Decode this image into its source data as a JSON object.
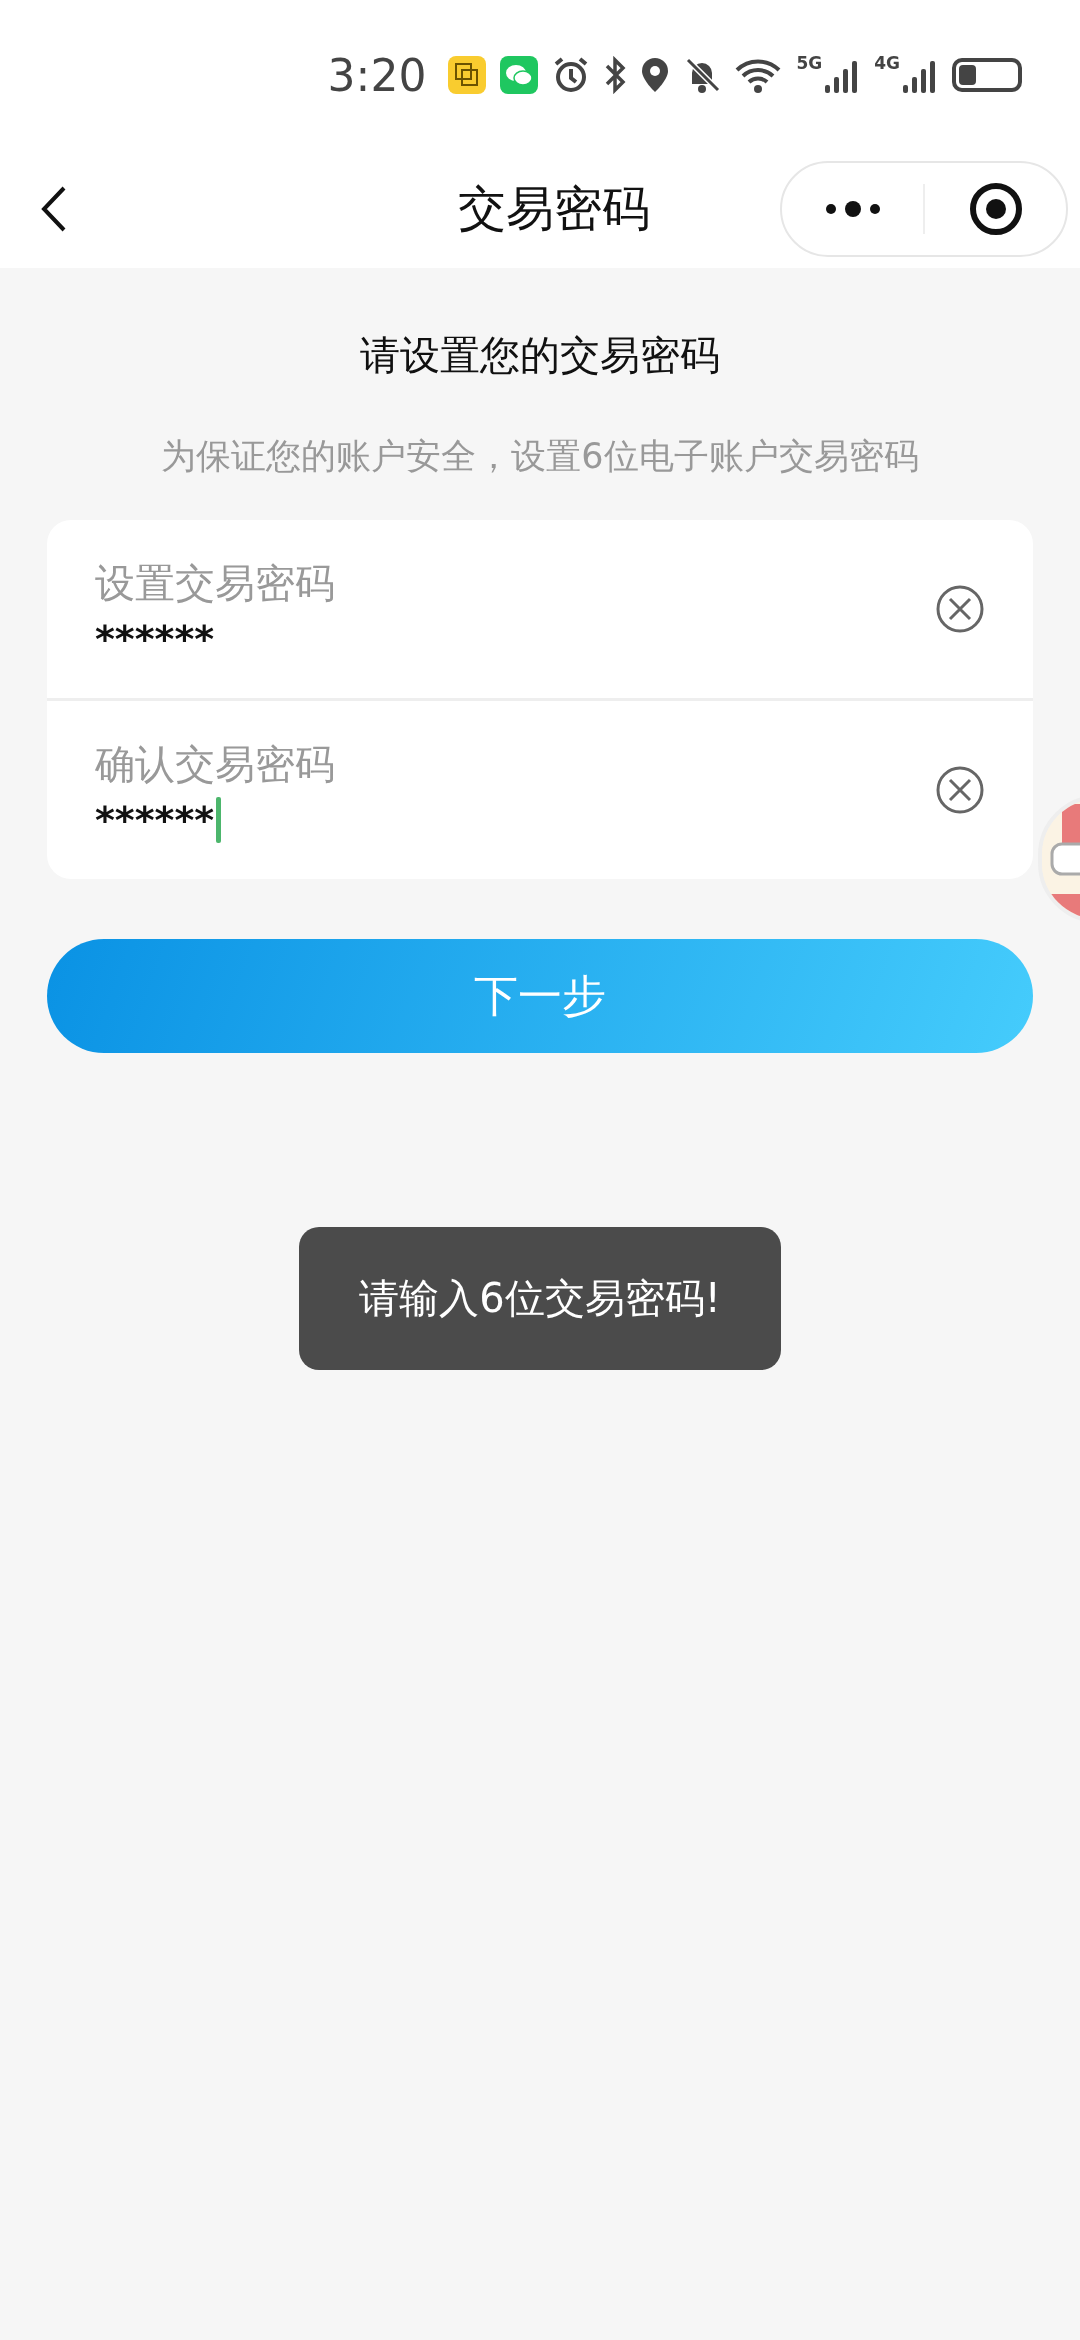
{
  "status_bar": {
    "time": "3:20",
    "network_1": "5G",
    "network_2": "4G"
  },
  "nav_bar": {
    "title": "交易密码"
  },
  "heading": "请设置您的交易密码",
  "subtitle": "为保证您的账户安全，设置6位电子账户交易密码",
  "fields": [
    {
      "label": "设置交易密码",
      "value": "******",
      "focused": false
    },
    {
      "label": "确认交易密码",
      "value": "******",
      "focused": true
    }
  ],
  "next_button": "下一步",
  "toast": "请输入6位交易密码!"
}
